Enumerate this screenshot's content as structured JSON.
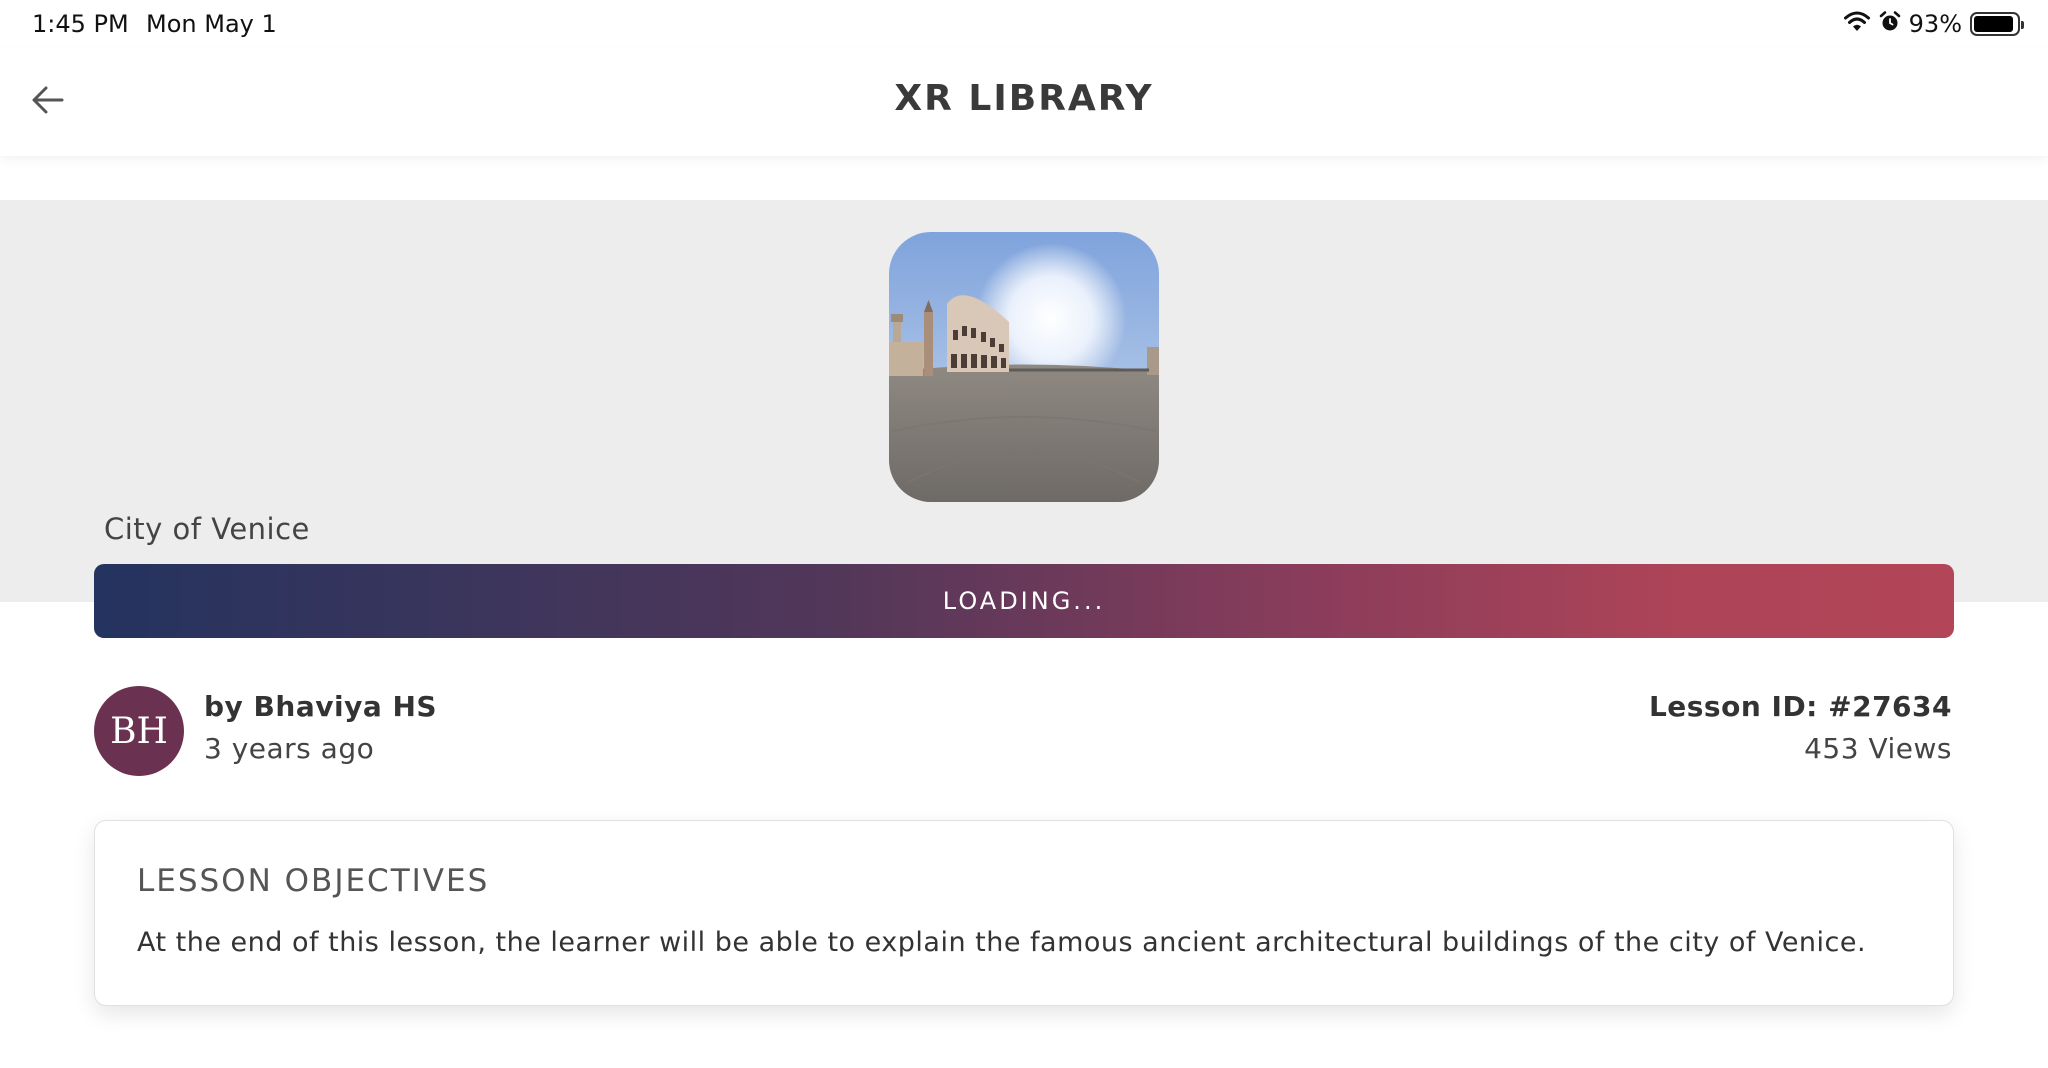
{
  "status_bar": {
    "time": "1:45 PM",
    "date": "Mon May 1",
    "battery_percent": "93%",
    "battery_level": 0.93,
    "icons": [
      "wifi-icon",
      "alarm-icon",
      "battery-icon"
    ]
  },
  "header": {
    "title": "XR LIBRARY",
    "back_icon": "arrow-left-icon"
  },
  "lesson": {
    "title": "City of Venice",
    "thumbnail": "venice-panorama-image",
    "loading_label": "LOADING...",
    "author": {
      "initials": "BH",
      "name": "by Bhaviya HS",
      "posted": "3 years ago"
    },
    "id_label": "Lesson ID: #27634",
    "views": "453 Views"
  },
  "objectives": {
    "heading": "LESSON OBJECTIVES",
    "text": "At the end of this lesson, the learner will be able to explain the famous ancient architectural buildings of the city of Venice."
  },
  "colors": {
    "gradient_start": "#24335f",
    "gradient_end": "#b24557",
    "avatar_bg": "#6a3150",
    "hero_bg": "#ededed"
  }
}
